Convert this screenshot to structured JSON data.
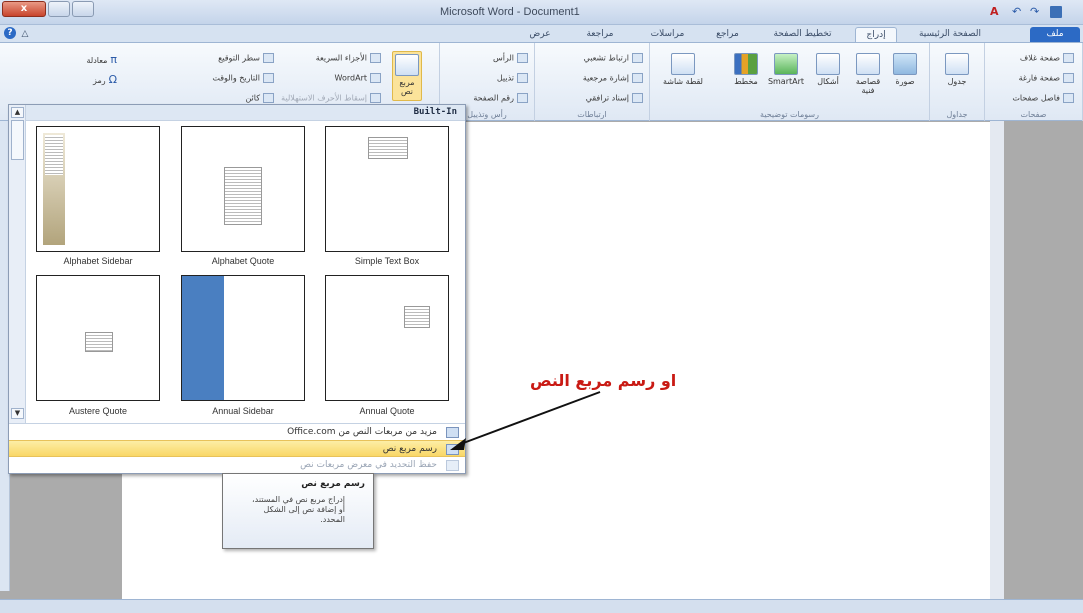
{
  "window": {
    "title": "Microsoft Word - Document1"
  },
  "tabs": {
    "file": "ملف",
    "home": "الصفحة الرئيسية",
    "insert": "إدراج",
    "layout": "تخطيط الصفحة",
    "references": "مراجع",
    "mailings": "مراسلات",
    "review": "مراجعة",
    "view": "عرض"
  },
  "ribbon": {
    "pages": {
      "cover": "صفحة غلاف",
      "blank": "صفحة فارغة",
      "break": "فاصل صفحات",
      "label": "صفحات"
    },
    "tables": {
      "table": "جدول",
      "label": "جداول"
    },
    "illustrations": {
      "picture": "صورة",
      "clipart": "قصاصة فنية",
      "shapes": "أشكال",
      "smartart": "SmartArt",
      "chart": "مخطط",
      "screenshot": "لقطة شاشة",
      "label": "رسومات توضيحية"
    },
    "links": {
      "hyperlink": "ارتباط تشعبي",
      "bookmark": "إشارة مرجعية",
      "crossref": "إسناد ترافقي",
      "label": "ارتباطات"
    },
    "header_footer": {
      "header": "الرأس",
      "footer": "تذييل",
      "page_number": "رقم الصفحة",
      "label": "رأس وتذييل"
    },
    "text": {
      "textbox": "مربع نص",
      "quickparts": "الأجزاء السريعة",
      "wordart": "WordArt",
      "dropcap": "إسقاط الأحرف الاستهلالية",
      "signature": "سطر التوقيع",
      "datetime": "التاريخ والوقت",
      "object": "كائن"
    },
    "symbols": {
      "equation": "معادلة",
      "symbol": "رمز"
    }
  },
  "gallery": {
    "header": "Built-In",
    "items": [
      "Alphabet Sidebar",
      "Alphabet Quote",
      "Simple Text Box",
      "Austere Quote",
      "Annual Sidebar",
      "Annual Quote"
    ],
    "menu": {
      "more": "مزيد من مربعات النص من Office.com",
      "draw": "رسم مربع نص",
      "save": "حفظ التحديد في معرض مربعات نص"
    }
  },
  "tooltip": {
    "title": "رسم مربع نص",
    "body": "إدراج مربع نص في المستند، أو إضافة نص إلى الشكل المحدد."
  },
  "annotation": "او رسم مربع النص",
  "colors": {
    "file_tab": "#2c6ac5",
    "highlight": "#f9d767",
    "annotation": "#c91a14",
    "sidebar_blue": "#4a7fc1"
  }
}
